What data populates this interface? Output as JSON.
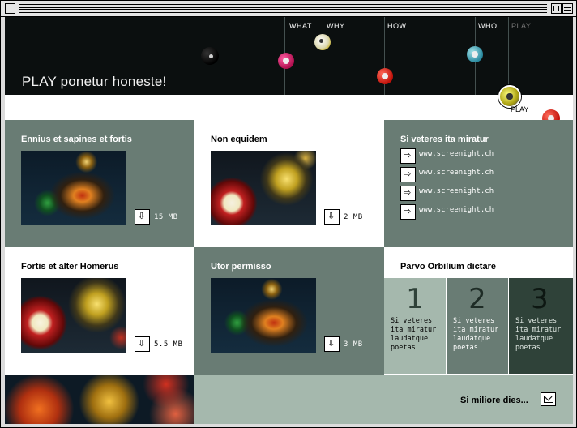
{
  "header": {
    "title": "PLAY ponetur honeste!",
    "nav": [
      {
        "label": "WHAT",
        "active": false
      },
      {
        "label": "WHY",
        "active": false
      },
      {
        "label": "HOW",
        "active": false
      },
      {
        "label": "WHO",
        "active": false
      },
      {
        "label": "PLAY",
        "active": true
      }
    ],
    "current_label": "PLAY"
  },
  "cells": {
    "c1": {
      "title": "Ennius et sapines et fortis",
      "size": "15 MB"
    },
    "c2": {
      "title": "Non equidem",
      "size": "2 MB"
    },
    "c3": {
      "title": "Si veteres ita miratur",
      "links": [
        "www.screenight.ch",
        "www.screenight.ch",
        "www.screenight.ch",
        "www.screenight.ch"
      ]
    },
    "c4": {
      "title": "Fortis et alter Homerus",
      "size": "5.5 MB"
    },
    "c5": {
      "title": "Utor permisso",
      "size": "3 MB"
    },
    "c6": {
      "title": "Parvo Orbilium dictare",
      "items": [
        {
          "number": "1",
          "text": "Si veteres ita miratur laudatque poetas"
        },
        {
          "number": "2",
          "text": "Si veteres ita miratur laudatque poetas"
        },
        {
          "number": "3",
          "text": "Si veteres ita miratur laudatque poetas"
        }
      ]
    }
  },
  "footer": {
    "text": "Si miliore dies..."
  },
  "icons": [
    "close-box-icon",
    "zoom-box-icon",
    "collapse-box-icon",
    "download-arrow-icon",
    "link-arrow-icon",
    "mail-icon",
    "billiard-ball-icon"
  ],
  "colors": {
    "dark_panel": "#697c74",
    "hero_bg": "#0b0f0f",
    "light_panel": "#a5b8ad",
    "darkest_panel": "#2f4239"
  }
}
